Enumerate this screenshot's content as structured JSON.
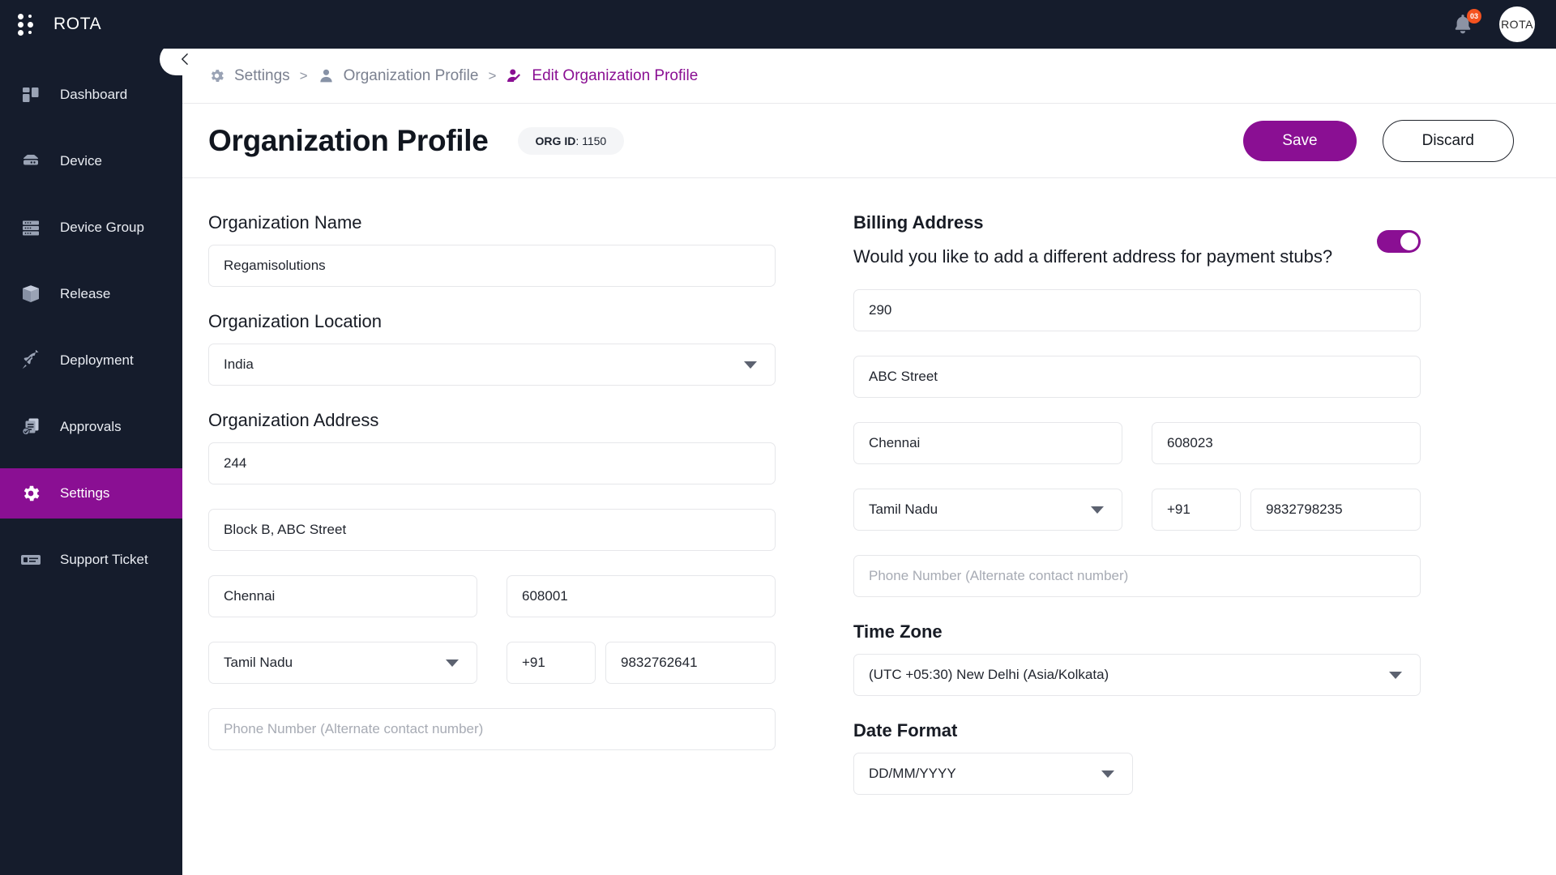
{
  "app": {
    "brand": "ROTA",
    "brand_icon": "dots-grid-icon",
    "notification_icon": "bell-icon",
    "notification_count": "03",
    "avatar_label": "ROTA"
  },
  "sidebar": {
    "collapse_icon": "chevron-left-icon",
    "items": [
      {
        "label": "Dashboard",
        "icon": "dashboard-icon",
        "active": false
      },
      {
        "label": "Device",
        "icon": "device-icon",
        "active": false
      },
      {
        "label": "Device Group",
        "icon": "device-group-icon",
        "active": false
      },
      {
        "label": "Release",
        "icon": "release-box-icon",
        "active": false
      },
      {
        "label": "Deployment",
        "icon": "rocket-icon",
        "active": false
      },
      {
        "label": "Approvals",
        "icon": "approvals-document-icon",
        "active": false
      },
      {
        "label": "Settings",
        "icon": "gear-icon",
        "active": true
      },
      {
        "label": "Support Ticket",
        "icon": "support-ticket-icon",
        "active": false
      }
    ]
  },
  "breadcrumb": {
    "items": [
      {
        "label": "Settings",
        "icon": "gear-icon",
        "active": false
      },
      {
        "label": "Organization Profile",
        "icon": "person-icon",
        "active": false
      },
      {
        "label": "Edit Organization Profile",
        "icon": "person-edit-icon",
        "active": true
      }
    ],
    "separator": ">"
  },
  "header": {
    "title": "Organization Profile",
    "org_id_label": "ORG ID",
    "org_id_value": ": 1150",
    "save_label": "Save",
    "discard_label": "Discard"
  },
  "left_form": {
    "org_name_label": "Organization Name",
    "org_name_value": "Regamisolutions",
    "org_location_label": "Organization Location",
    "org_location_value": "India",
    "org_address_label": "Organization Address",
    "address_line1": "244",
    "address_line2": "Block B, ABC Street",
    "city": "Chennai",
    "postal_code": "608001",
    "state": "Tamil Nadu",
    "country_code": "+91",
    "phone": "9832762641",
    "alt_phone_placeholder": "Phone Number (Alternate contact number)"
  },
  "right_form": {
    "billing_title": "Billing Address",
    "billing_question": "Would you like to add a different address for payment stubs?",
    "toggle_state": "on",
    "address_line1": "290",
    "address_line2": "ABC Street",
    "city": "Chennai",
    "postal_code": "608023",
    "state": "Tamil Nadu",
    "country_code": "+91",
    "phone": "9832798235",
    "alt_phone_placeholder": "Phone Number (Alternate contact number)",
    "timezone_label": "Time Zone",
    "timezone_value": "(UTC +05:30) New Delhi (Asia/Kolkata)",
    "date_format_label": "Date Format",
    "date_format_value": "DD/MM/YYYY"
  },
  "colors": {
    "accent": "#8a0f93",
    "sidebar_bg": "#151c2c",
    "badge": "#f4521f"
  }
}
